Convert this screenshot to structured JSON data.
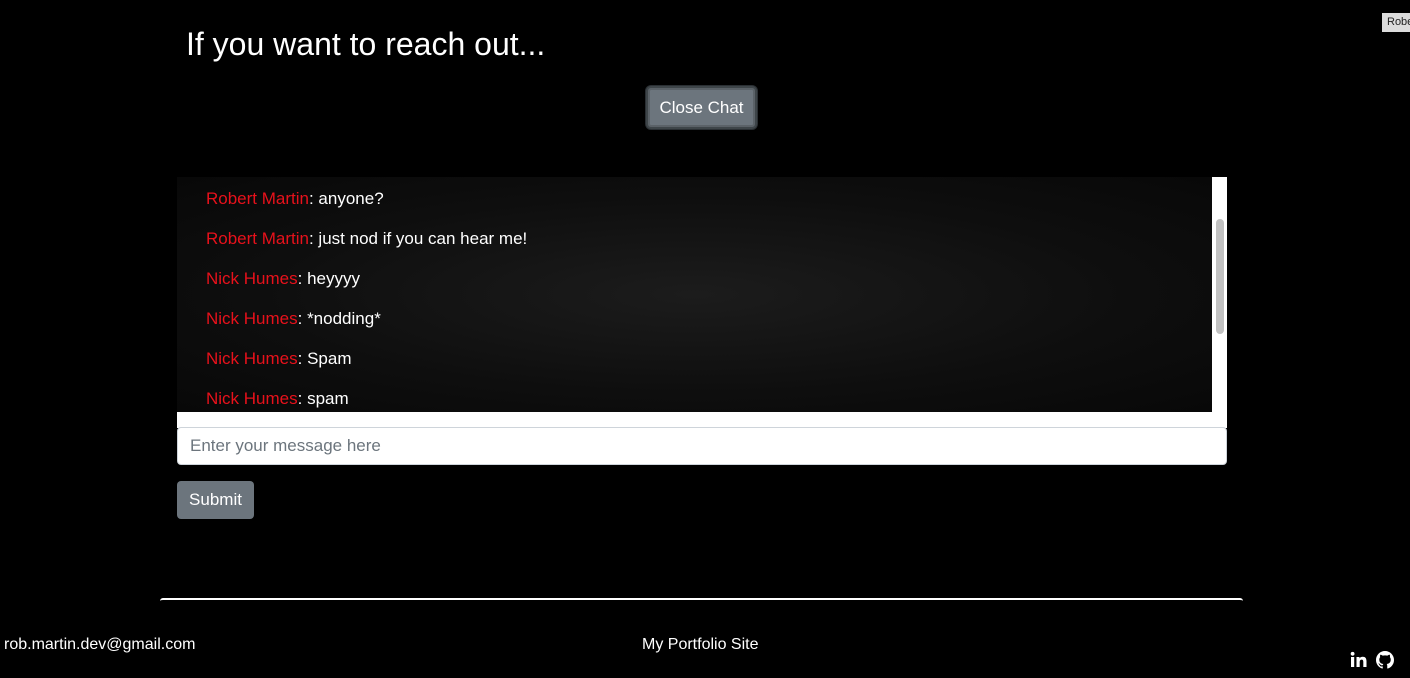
{
  "corner_tag": "Robert Martin",
  "heading": "If you want to reach out...",
  "close_chat_label": "Close Chat",
  "messages": [
    {
      "author": "Robert Martin",
      "text": ": anyone?"
    },
    {
      "author": "Robert Martin",
      "text": ": just nod if you can hear me!"
    },
    {
      "author": "Nick Humes",
      "text": ": heyyyy"
    },
    {
      "author": "Nick Humes",
      "text": ": *nodding*"
    },
    {
      "author": "Nick Humes",
      "text": ": Spam"
    },
    {
      "author": "Nick Humes",
      "text": ": spam"
    }
  ],
  "message_input": {
    "placeholder": "Enter your message here",
    "value": ""
  },
  "submit_label": "Submit",
  "footer": {
    "email": "rob.martin.dev@gmail.com",
    "site": "My Portfolio Site",
    "icons": [
      "linkedin-icon",
      "github-icon"
    ]
  },
  "colors": {
    "background": "#000000",
    "author_name": "#e8111b",
    "button": "#6c757d"
  }
}
